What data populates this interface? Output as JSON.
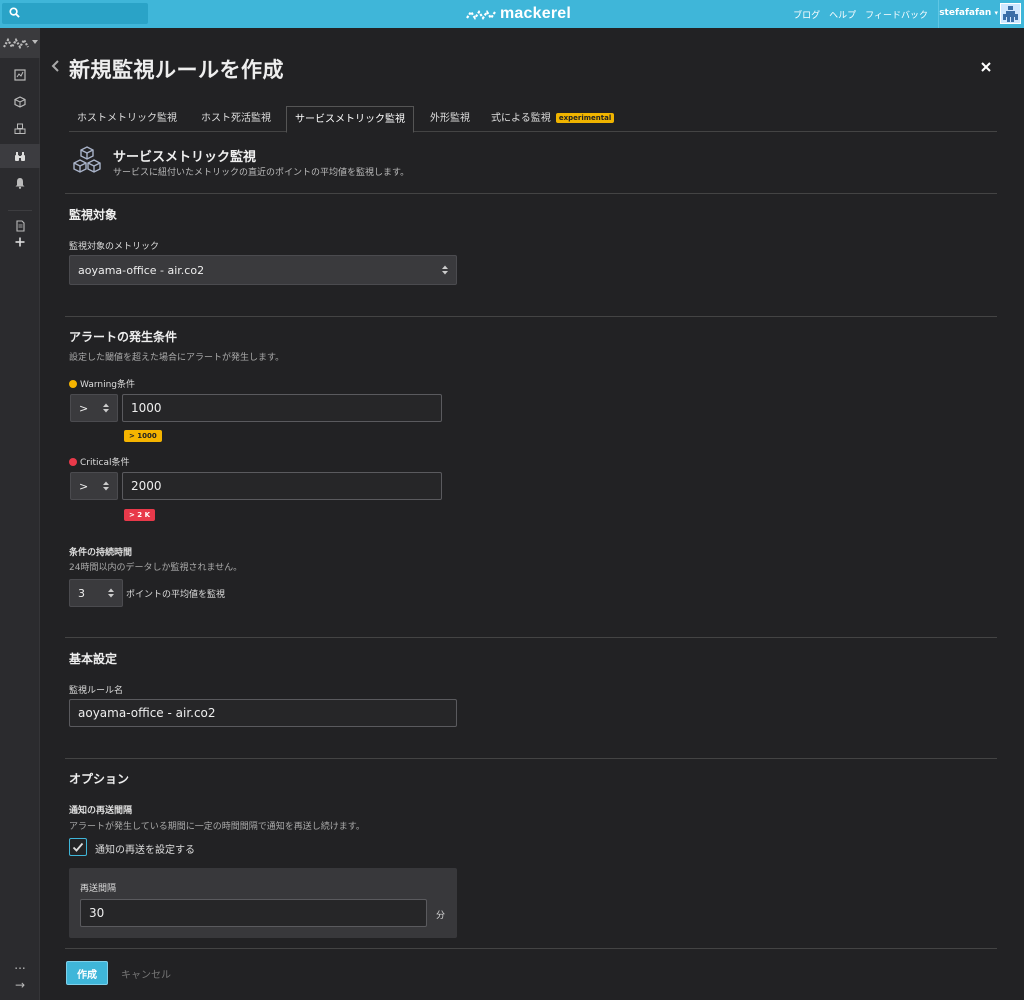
{
  "topbar": {
    "search_placeholder": "",
    "logo": "mackerel",
    "nav": [
      "ブログ",
      "ヘルプ",
      "フィードバック"
    ],
    "user": "stefafafan",
    "accent_color": "#3fb6d9"
  },
  "sidebar": {
    "items": [
      "dashboard-icon",
      "cube-icon",
      "cubes-icon",
      "binoculars-icon",
      "bell-icon",
      "document-icon",
      "plus-icon"
    ],
    "active": "binoculars-icon",
    "bottom": [
      "...",
      "→"
    ]
  },
  "page": {
    "title": "新規監視ルールを作成"
  },
  "tabs": [
    {
      "label": "ホストメトリック監視",
      "active": false
    },
    {
      "label": "ホスト死活監視",
      "active": false
    },
    {
      "label": "サービスメトリック監視",
      "active": true
    },
    {
      "label": "外形監視",
      "active": false
    },
    {
      "label": "式による監視",
      "active": false,
      "badge": "experimental"
    }
  ],
  "service": {
    "title": "サービスメトリック監視",
    "desc": "サービスに紐付いたメトリックの直近のポイントの平均値を監視します。"
  },
  "target": {
    "heading": "監視対象",
    "metric_label": "監視対象のメトリック",
    "metric_value": "aoyama-office - air.co2"
  },
  "alert": {
    "heading": "アラートの発生条件",
    "help": "設定した閾値を超えた場合にアラートが発生します。",
    "warning": {
      "label": "Warning条件",
      "op": ">",
      "value": "1000",
      "preview": "> 1000",
      "color": "#f5b400"
    },
    "critical": {
      "label": "Critical条件",
      "op": ">",
      "value": "2000",
      "preview": "> 2 K",
      "color": "#e8394a"
    },
    "duration_label": "条件の持続時間",
    "duration_help": "24時間以内のデータしか監視されません。",
    "duration_value": "3",
    "duration_suffix": "ポイントの平均値を監視"
  },
  "basic": {
    "heading": "基本設定",
    "name_label": "監視ルール名",
    "name_value": "aoyama-office - air.co2"
  },
  "options": {
    "heading": "オプション",
    "renotify_label": "通知の再送間隔",
    "renotify_help": "アラートが発生している期間に一定の時間間隔で通知を再送し続けます。",
    "renotify_checkbox": "通知の再送を設定する",
    "renotify_checked": true,
    "interval_label": "再送間隔",
    "interval_value": "30",
    "interval_unit": "分"
  },
  "footer": {
    "create": "作成",
    "cancel": "キャンセル"
  }
}
